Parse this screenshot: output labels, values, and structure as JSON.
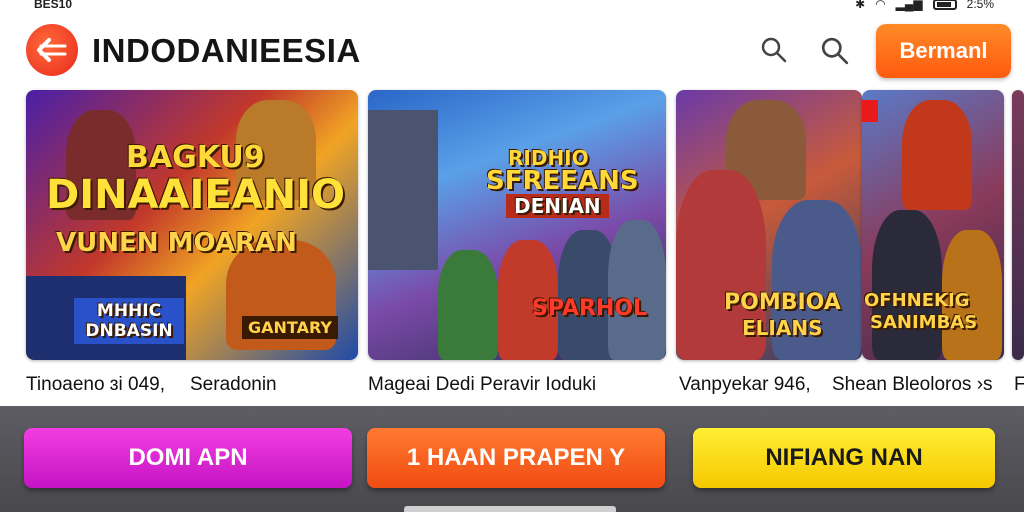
{
  "status_bar": {
    "time": "BES10",
    "battery_text": "2:5%"
  },
  "header": {
    "title": "INDODANIEESIA",
    "primary_button": "Bermanl",
    "back_icon": "back-arrow-icon",
    "search_icon": "search-icon"
  },
  "cards": [
    {
      "art_line1": "BAGKU9",
      "art_line2": "DINAAIEANIO",
      "art_line3": "VUNEN MOARAN",
      "art_line4": "MHHIC DNBASIN",
      "art_line5": "GANTARY"
    },
    {
      "art_line1": "RIDHIO",
      "art_line2": "SFREEANS",
      "art_line3": "DENIAN",
      "art_line4": "SPARHOL"
    },
    {
      "art_line1": "POMBIOA",
      "art_line2": "ELIANS"
    },
    {
      "art_line1": "OFHNEKIG",
      "art_line2": "SANIMBAS"
    }
  ],
  "labels": [
    "Tinoaeno ɜi 049,",
    "Seradonin",
    "Mageai Dedi Peravir Ioduki",
    "Vanpyekar 946,",
    "Shean Bleoloros ›s",
    "F"
  ],
  "bottom": {
    "cta1": "DOMI APN",
    "cta2": "1 HAAN PRAPEN Y",
    "cta3": "NIFIANG NAN"
  },
  "colors": {
    "accent_orange": "#ff6a1a",
    "magenta": "#e02bd6",
    "yellow": "#f7d20a"
  }
}
